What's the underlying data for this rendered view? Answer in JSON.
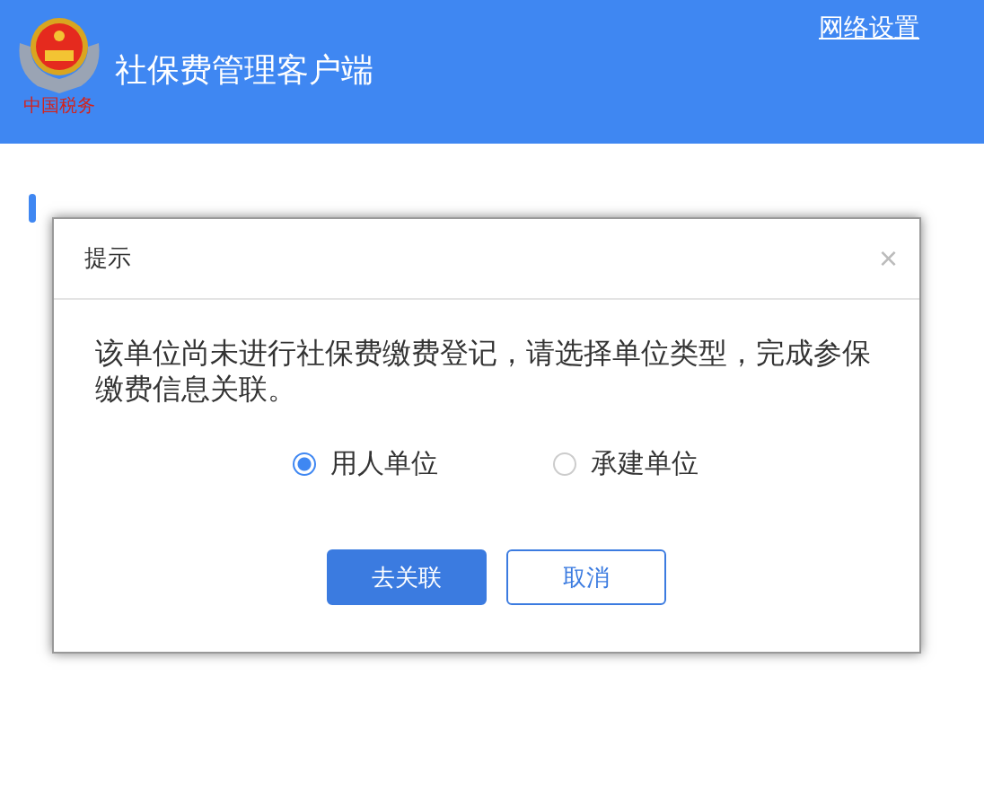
{
  "header": {
    "logo_text": "中国税务",
    "title": "社保费管理客户端",
    "link": "网络设置"
  },
  "dialog": {
    "title": "提示",
    "close": "×",
    "message": "该单位尚未进行社保费缴费登记，请选择单位类型，完成参保缴费信息关联。",
    "options": [
      {
        "label": "用人单位",
        "selected": true
      },
      {
        "label": "承建单位",
        "selected": false
      }
    ],
    "buttons": [
      {
        "label": "去关联",
        "kind": "primary"
      },
      {
        "label": "取消",
        "kind": "secondary"
      }
    ]
  }
}
